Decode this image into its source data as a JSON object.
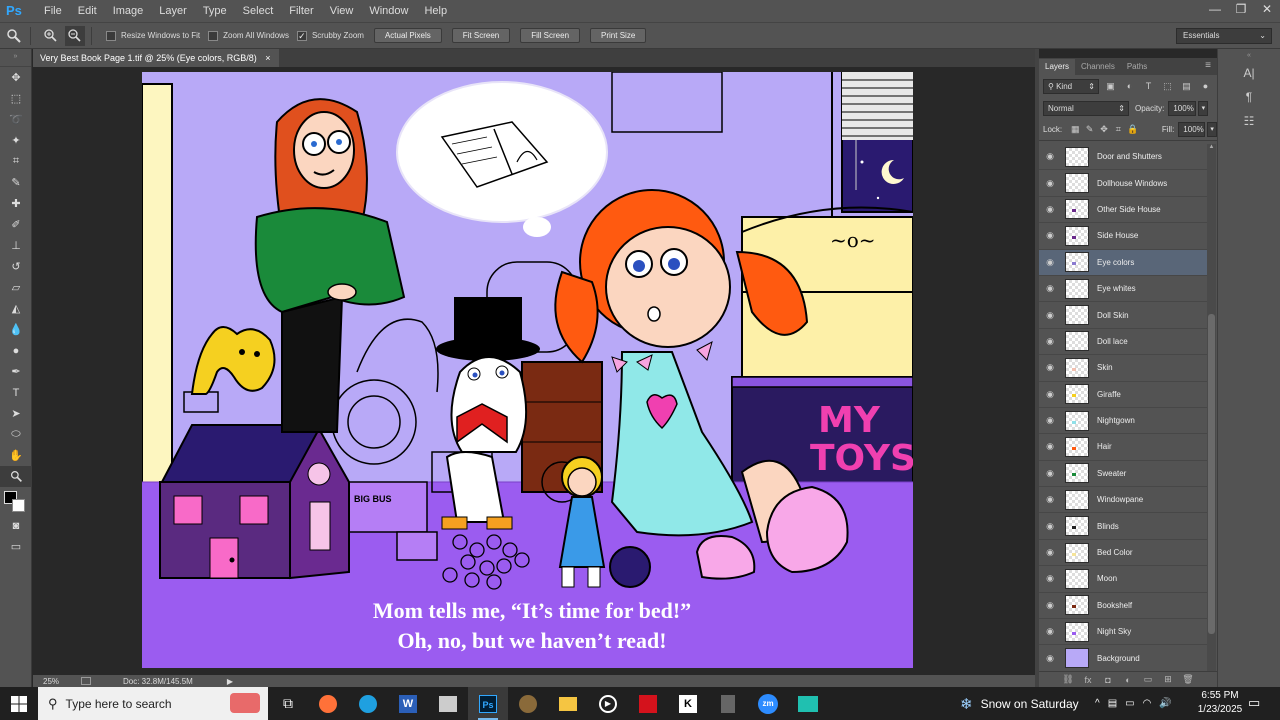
{
  "app": {
    "logo": "Ps"
  },
  "menu": [
    "File",
    "Edit",
    "Image",
    "Layer",
    "Type",
    "Select",
    "Filter",
    "View",
    "Window",
    "Help"
  ],
  "window_controls": {
    "minimize": "—",
    "restore": "❐",
    "close": "✕"
  },
  "options": {
    "resize_windows": "Resize Windows to Fit",
    "zoom_all": "Zoom All Windows",
    "scrubby_zoom": "Scrubby Zoom",
    "actual_pixels": "Actual Pixels",
    "fit_screen": "Fit Screen",
    "fill_screen": "Fill Screen",
    "print_size": "Print Size",
    "workspace": "Essentials"
  },
  "document": {
    "tab_title": "Very Best Book Page 1.tif @ 25% (Eye colors, RGB/8)",
    "close": "×",
    "caption_line1": "Mom tells me, “It’s time for bed!”",
    "caption_line2": "Oh, no, but we haven’t read!",
    "sign_line1": "MY",
    "sign_line2": "TOYS"
  },
  "status": {
    "zoom": "25%",
    "doc": "Doc: 32.8M/145.5M"
  },
  "layers_panel": {
    "tabs": [
      "Layers",
      "Channels",
      "Paths"
    ],
    "kind": "Kind",
    "blend_mode": "Normal",
    "opacity_label": "Opacity:",
    "opacity_value": "100%",
    "lock_label": "Lock:",
    "fill_label": "Fill:",
    "fill_value": "100%",
    "selected": "Eye colors",
    "layers": [
      {
        "name": "Door and Shutters",
        "mark": ""
      },
      {
        "name": "Dollhouse Windows",
        "mark": ""
      },
      {
        "name": "Other Side House",
        "mark": "#6a2a8a"
      },
      {
        "name": "Side House",
        "mark": "#6a2a8a"
      },
      {
        "name": "Eye colors",
        "mark": "#8a7ad0"
      },
      {
        "name": "Eye whites",
        "mark": ""
      },
      {
        "name": "Doll Skin",
        "mark": ""
      },
      {
        "name": "Doll lace",
        "mark": ""
      },
      {
        "name": "Skin",
        "mark": "#f2c0b0"
      },
      {
        "name": "Giraffe",
        "mark": "#f5d020"
      },
      {
        "name": "Nightgown",
        "mark": "#90e0e8"
      },
      {
        "name": "Hair",
        "mark": "#ff5a10"
      },
      {
        "name": "Sweater",
        "mark": "#1a8a3a"
      },
      {
        "name": "Windowpane",
        "mark": ""
      },
      {
        "name": "Blinds",
        "mark": "#222222"
      },
      {
        "name": "Bed Color",
        "mark": "#f5e49a"
      },
      {
        "name": "Moon",
        "mark": ""
      },
      {
        "name": "Bookshelf",
        "mark": "#7a2a12"
      },
      {
        "name": "Night Sky",
        "mark": "#9a5cf0"
      },
      {
        "name": "Background",
        "mark": "solid"
      }
    ]
  },
  "taskbar": {
    "search_placeholder": "Type here to search",
    "weather": "Snow on Saturday",
    "time": "6:55 PM",
    "date": "1/23/2025"
  },
  "colors": {
    "ui": "#535353",
    "accent": "#31a8ff",
    "canvas_bg": "#b8a9f7",
    "floor": "#9b5cf0"
  }
}
